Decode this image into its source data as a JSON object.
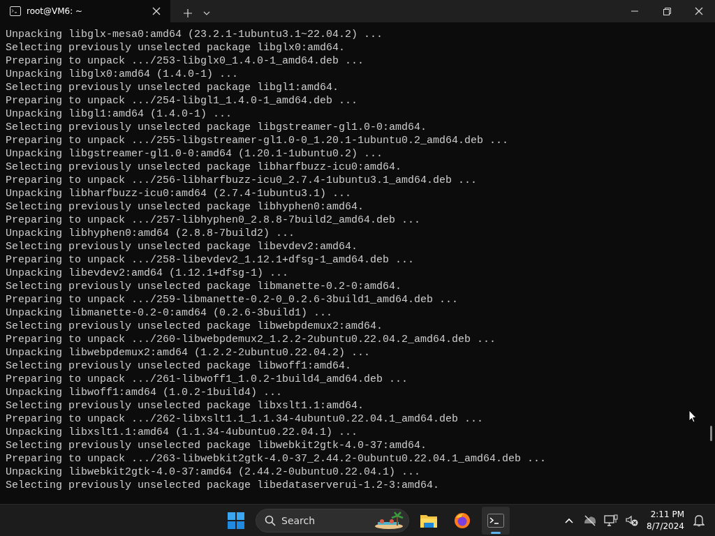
{
  "window": {
    "title": "root@VM6: ~"
  },
  "terminal": {
    "lines": [
      "Unpacking libglx-mesa0:amd64 (23.2.1-1ubuntu3.1~22.04.2) ...",
      "Selecting previously unselected package libglx0:amd64.",
      "Preparing to unpack .../253-libglx0_1.4.0-1_amd64.deb ...",
      "Unpacking libglx0:amd64 (1.4.0-1) ...",
      "Selecting previously unselected package libgl1:amd64.",
      "Preparing to unpack .../254-libgl1_1.4.0-1_amd64.deb ...",
      "Unpacking libgl1:amd64 (1.4.0-1) ...",
      "Selecting previously unselected package libgstreamer-gl1.0-0:amd64.",
      "Preparing to unpack .../255-libgstreamer-gl1.0-0_1.20.1-1ubuntu0.2_amd64.deb ...",
      "Unpacking libgstreamer-gl1.0-0:amd64 (1.20.1-1ubuntu0.2) ...",
      "Selecting previously unselected package libharfbuzz-icu0:amd64.",
      "Preparing to unpack .../256-libharfbuzz-icu0_2.7.4-1ubuntu3.1_amd64.deb ...",
      "Unpacking libharfbuzz-icu0:amd64 (2.7.4-1ubuntu3.1) ...",
      "Selecting previously unselected package libhyphen0:amd64.",
      "Preparing to unpack .../257-libhyphen0_2.8.8-7build2_amd64.deb ...",
      "Unpacking libhyphen0:amd64 (2.8.8-7build2) ...",
      "Selecting previously unselected package libevdev2:amd64.",
      "Preparing to unpack .../258-libevdev2_1.12.1+dfsg-1_amd64.deb ...",
      "Unpacking libevdev2:amd64 (1.12.1+dfsg-1) ...",
      "Selecting previously unselected package libmanette-0.2-0:amd64.",
      "Preparing to unpack .../259-libmanette-0.2-0_0.2.6-3build1_amd64.deb ...",
      "Unpacking libmanette-0.2-0:amd64 (0.2.6-3build1) ...",
      "Selecting previously unselected package libwebpdemux2:amd64.",
      "Preparing to unpack .../260-libwebpdemux2_1.2.2-2ubuntu0.22.04.2_amd64.deb ...",
      "Unpacking libwebpdemux2:amd64 (1.2.2-2ubuntu0.22.04.2) ...",
      "Selecting previously unselected package libwoff1:amd64.",
      "Preparing to unpack .../261-libwoff1_1.0.2-1build4_amd64.deb ...",
      "Unpacking libwoff1:amd64 (1.0.2-1build4) ...",
      "Selecting previously unselected package libxslt1.1:amd64.",
      "Preparing to unpack .../262-libxslt1.1_1.1.34-4ubuntu0.22.04.1_amd64.deb ...",
      "Unpacking libxslt1.1:amd64 (1.1.34-4ubuntu0.22.04.1) ...",
      "Selecting previously unselected package libwebkit2gtk-4.0-37:amd64.",
      "Preparing to unpack .../263-libwebkit2gtk-4.0-37_2.44.2-0ubuntu0.22.04.1_amd64.deb ...",
      "Unpacking libwebkit2gtk-4.0-37:amd64 (2.44.2-0ubuntu0.22.04.1) ...",
      "Selecting previously unselected package libedataserverui-1.2-3:amd64."
    ]
  },
  "taskbar": {
    "search": {
      "label": "Search"
    },
    "apps": [
      {
        "kind": "files",
        "selected": false
      },
      {
        "kind": "browser",
        "selected": false
      },
      {
        "kind": "terminal",
        "selected": true
      }
    ],
    "clock": {
      "time": "2:11 PM",
      "date": "8/7/2024"
    }
  }
}
